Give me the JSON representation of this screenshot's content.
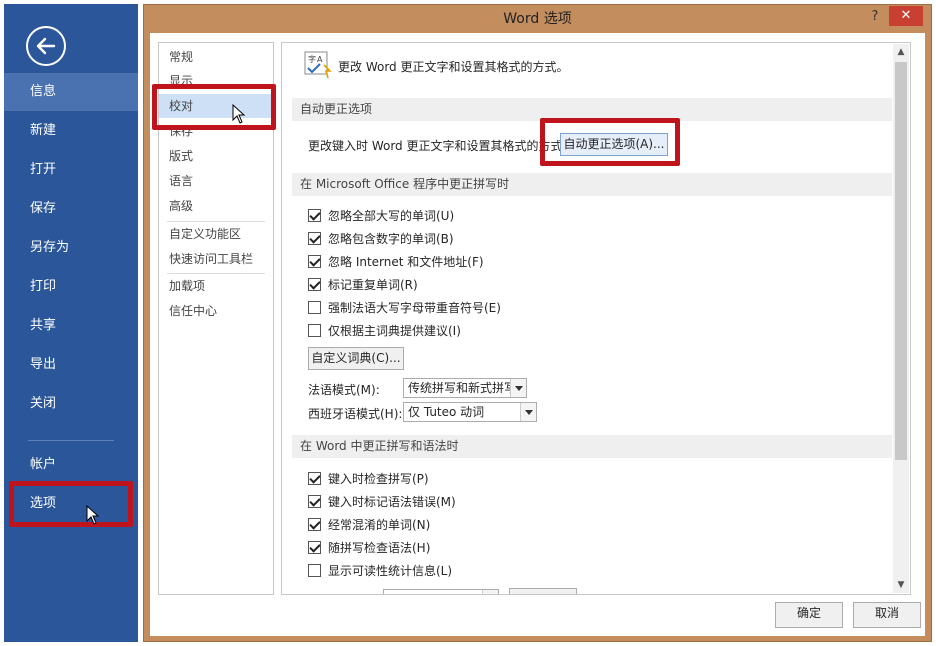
{
  "backstage": {
    "items": [
      "信息",
      "新建",
      "打开",
      "保存",
      "另存为",
      "打印",
      "共享",
      "导出",
      "关闭",
      "帐户",
      "选项"
    ]
  },
  "window": {
    "title": "Word 选项",
    "help": "?",
    "close": "✕"
  },
  "nav": {
    "items": [
      "常规",
      "显示",
      "校对",
      "保存",
      "版式",
      "语言",
      "高级",
      "自定义功能区",
      "快速访问工具栏",
      "加载项",
      "信任中心"
    ]
  },
  "main": {
    "intro": "更改 Word 更正文字和设置其格式的方式。",
    "section1": "自动更正选项",
    "autocorrect_label": "更改键入时 Word 更正文字和设置其格式的方式：",
    "autocorrect_button": "自动更正选项(A)...",
    "section2": "在 Microsoft Office 程序中更正拼写时",
    "office_checks": [
      {
        "label": "忽略全部大写的单词(U)",
        "checked": true
      },
      {
        "label": "忽略包含数字的单词(B)",
        "checked": true
      },
      {
        "label": "忽略 Internet 和文件地址(F)",
        "checked": true
      },
      {
        "label": "标记重复单词(R)",
        "checked": true
      },
      {
        "label": "强制法语大写字母带重音符号(E)",
        "checked": false
      },
      {
        "label": "仅根据主词典提供建议(I)",
        "checked": false
      }
    ],
    "custom_dict_button": "自定义词典(C)...",
    "french_label": "法语模式(M):",
    "french_value": "传统拼写和新式拼写",
    "spanish_label": "西班牙语模式(H):",
    "spanish_value": "仅 Tuteo 动词",
    "section3": "在 Word 中更正拼写和语法时",
    "word_checks": [
      {
        "label": "键入时检查拼写(P)",
        "checked": true
      },
      {
        "label": "键入时标记语法错误(M)",
        "checked": true
      },
      {
        "label": "经常混淆的单词(N)",
        "checked": true
      },
      {
        "label": "随拼写检查语法(H)",
        "checked": true
      },
      {
        "label": "显示可读性统计信息(L)",
        "checked": false
      }
    ]
  },
  "footer": {
    "ok": "确定",
    "cancel": "取消"
  },
  "colors": {
    "backstage_bg": "#2b579a",
    "highlight_red": "#c0141c",
    "window_frame": "#c48d5e"
  }
}
